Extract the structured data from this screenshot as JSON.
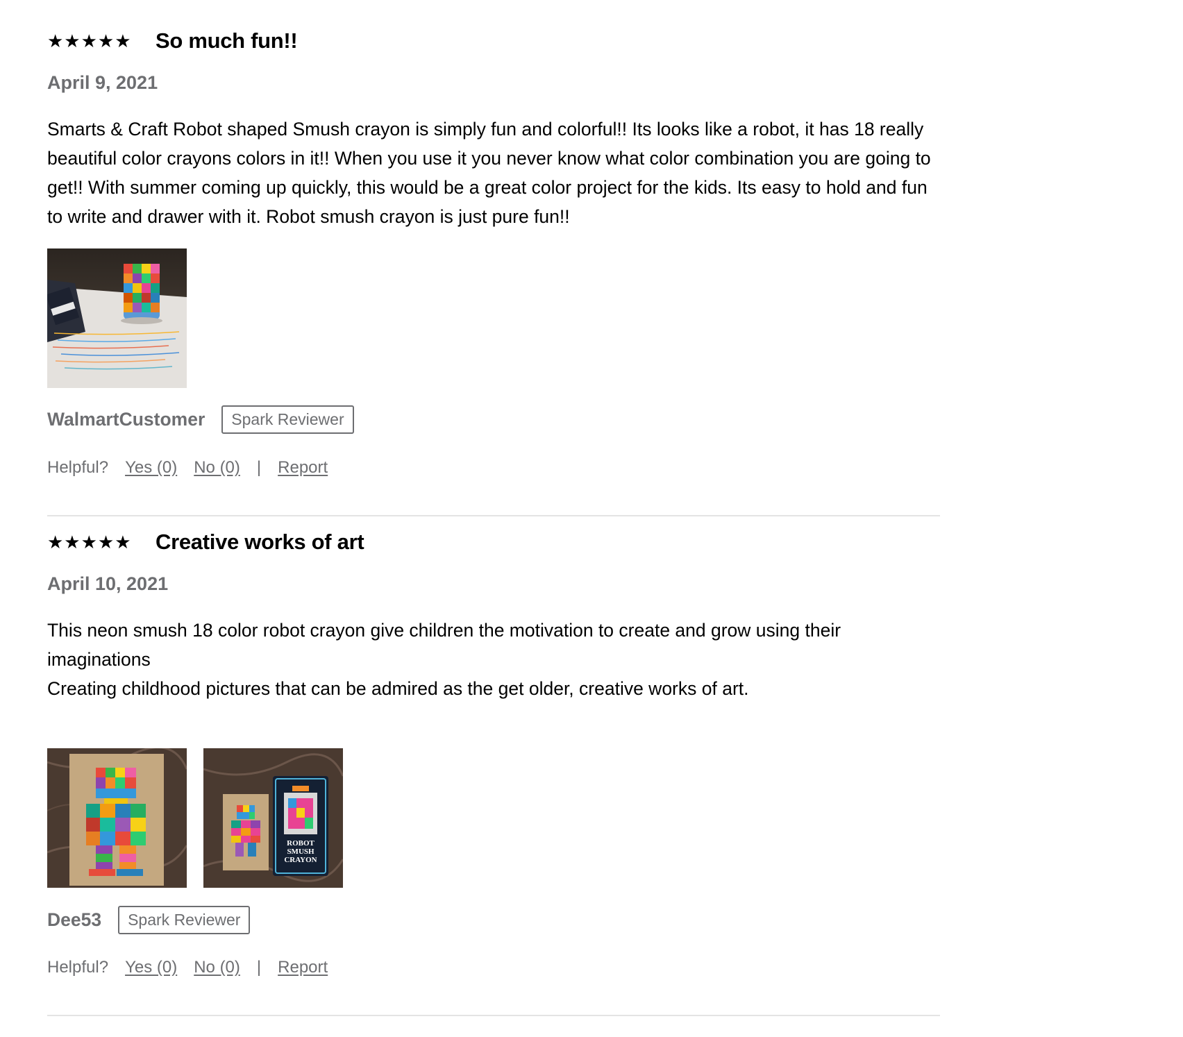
{
  "reviews": [
    {
      "stars": "★★★★★",
      "rating": 5,
      "title": "So much fun!!",
      "date": "April 9, 2021",
      "body": "Smarts & Craft Robot shaped Smush crayon is simply fun and colorful!! Its looks like a robot, it has 18 really beautiful color crayons colors in it!! When you use it you never know what color combination you are going to get!! With summer coming up quickly, this would be a great color project for the kids. Its easy to hold and fun to write and drawer with it. Robot smush crayon is just pure fun!!",
      "author": "WalmartCustomer",
      "badge": "Spark Reviewer",
      "helpful_label": "Helpful?",
      "yes_label": "Yes (0)",
      "no_label": "No (0)",
      "separator": "|",
      "report_label": "Report"
    },
    {
      "stars": "★★★★★",
      "rating": 5,
      "title": "Creative works of art",
      "date": "April 10, 2021",
      "body": "This neon smush 18 color robot crayon give children the motivation to create and grow using their imaginations\nCreating childhood pictures that can be admired as the get older, creative works of art.",
      "author": "Dee53",
      "badge": "Spark Reviewer",
      "helpful_label": "Helpful?",
      "yes_label": "Yes (0)",
      "no_label": "No (0)",
      "separator": "|",
      "report_label": "Report",
      "package_text": [
        "ROBOT",
        "SMUSH",
        "CRAYON"
      ]
    }
  ],
  "colors": {
    "text": "#000000",
    "muted": "#6d6e71",
    "divider": "#e4e4e4"
  }
}
